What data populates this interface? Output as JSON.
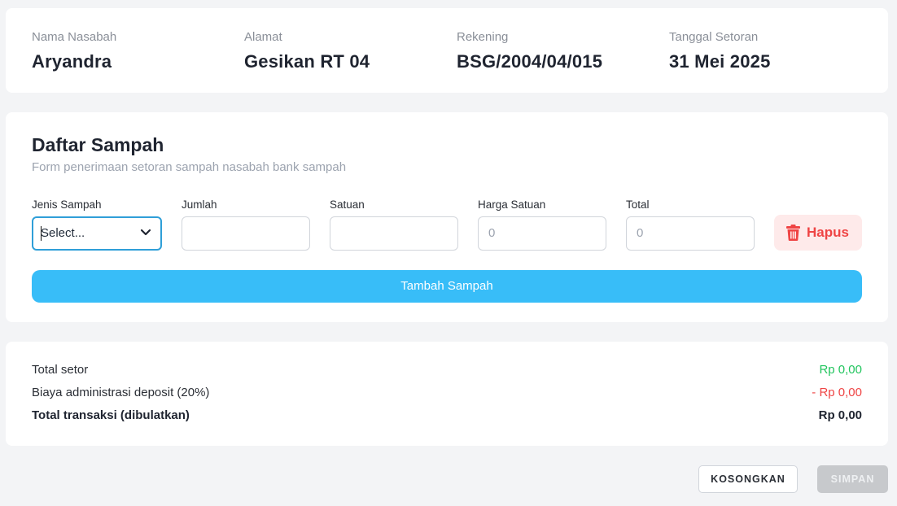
{
  "nasabah": {
    "nama_label": "Nama Nasabah",
    "nama": "Aryandra",
    "alamat_label": "Alamat",
    "alamat": "Gesikan RT 04",
    "rekening_label": "Rekening",
    "rekening": "BSG/2004/04/015",
    "tanggal_label": "Tanggal Setoran",
    "tanggal": "31 Mei 2025"
  },
  "daftar": {
    "title": "Daftar Sampah",
    "subtitle": "Form penerimaan setoran sampah nasabah bank sampah",
    "labels": {
      "jenis": "Jenis Sampah",
      "jumlah": "Jumlah",
      "satuan": "Satuan",
      "harga": "Harga Satuan",
      "total": "Total"
    },
    "row": {
      "jenis_value": "Select...",
      "jumlah_value": "",
      "satuan_value": "",
      "harga_value": "0",
      "total_value": "0"
    },
    "hapus_label": "Hapus",
    "tambah_label": "Tambah Sampah"
  },
  "ringkasan": {
    "total_setor_label": "Total setor",
    "total_setor_value": "Rp 0,00",
    "biaya_label": "Biaya administrasi deposit (20%)",
    "biaya_value": "- Rp 0,00",
    "total_transaksi_label": "Total transaksi (dibulatkan)",
    "total_transaksi_value": "Rp 0,00"
  },
  "actions": {
    "kosongkan_label": "KOSONGKAN",
    "simpan_label": "SIMPAN"
  },
  "colors": {
    "accent": "#38bdf8",
    "focus": "#2f9fd8",
    "positive": "#22c55e",
    "negative": "#ef4444",
    "disabled": "#c7c9cc"
  },
  "icons": {
    "select_chevron": "chevron-down-icon",
    "hapus": "trash-icon"
  }
}
